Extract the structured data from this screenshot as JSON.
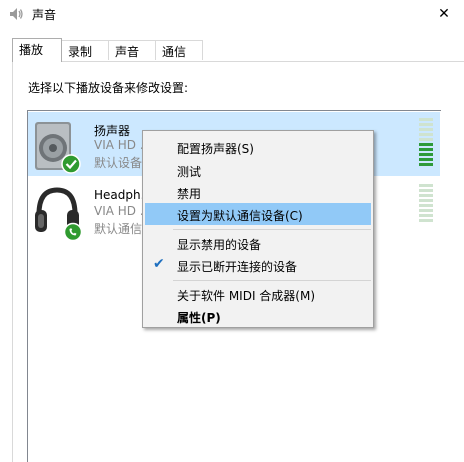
{
  "window": {
    "title": "声音",
    "icon": "speaker-icon",
    "close_glyph": "✕"
  },
  "tabs": [
    {
      "label": "播放",
      "active": true
    },
    {
      "label": "录制",
      "active": false
    },
    {
      "label": "声音",
      "active": false
    },
    {
      "label": "通信",
      "active": false
    }
  ],
  "instruction": "选择以下播放设备来修改设置:",
  "devices": [
    {
      "name": "扬声器",
      "line1": "VIA HD ...",
      "line2": "默认设备",
      "status": "default-device",
      "selected": true,
      "meter_level": 0.4
    },
    {
      "name": "Headph...",
      "line1": "VIA HD ...",
      "line2": "默认通信...",
      "status": "default-communication",
      "selected": false,
      "meter_level": 0
    }
  ],
  "context_menu": {
    "items": [
      {
        "label": "配置扬声器(S)"
      },
      {
        "label": "测试"
      },
      {
        "label": "禁用"
      },
      {
        "label": "设置为默认通信设备(C)",
        "highlighted": true
      },
      {
        "label": "显示禁用的设备"
      },
      {
        "label": "显示已断开连接的设备",
        "checked": true
      },
      {
        "label": "关于软件 MIDI 合成器(M)"
      },
      {
        "label": "属性(P)",
        "bold": true
      }
    ]
  },
  "colors": {
    "selection": "#cce8ff",
    "menu_highlight": "#91c9f7",
    "meter_on": "#2e9a3a",
    "meter_off": "#cfe3cf"
  }
}
